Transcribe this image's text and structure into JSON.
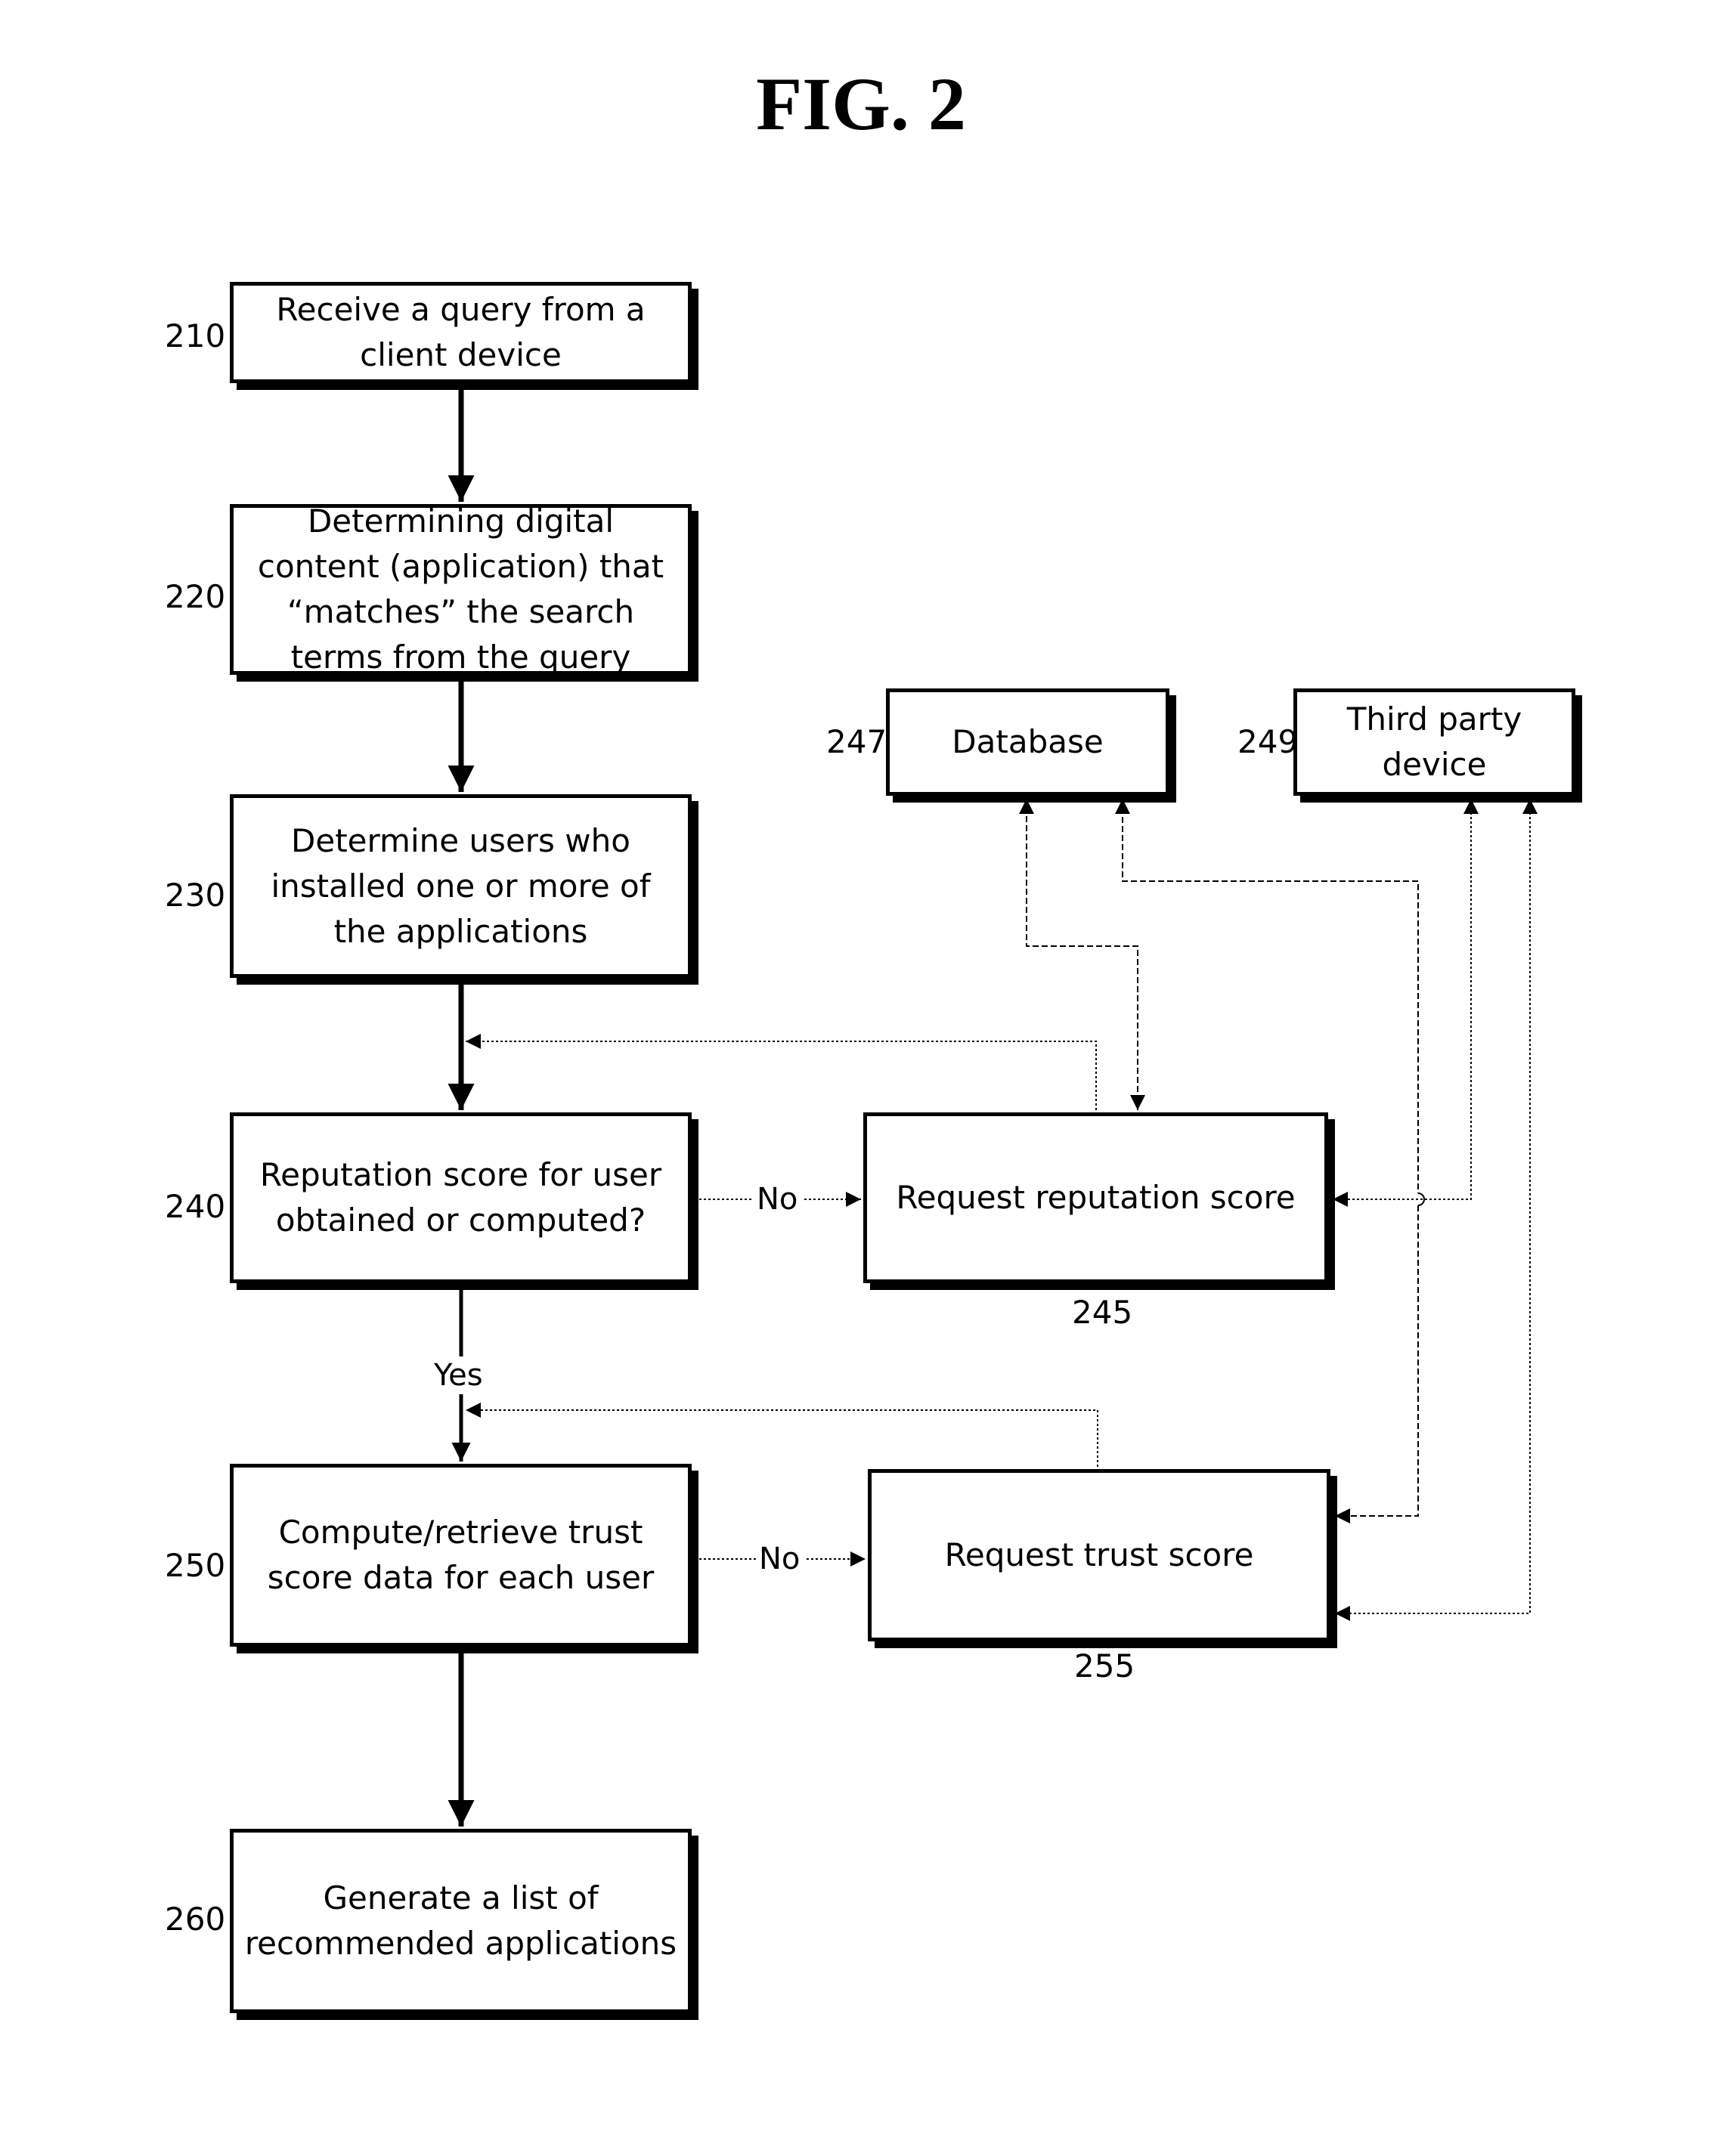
{
  "figure": {
    "title": "FIG. 2"
  },
  "nodes": {
    "n210": {
      "ref": "210",
      "text": "Receive a query from a client device"
    },
    "n220": {
      "ref": "220",
      "text": "Determining digital content (application) that “matches” the search terms from the query"
    },
    "n230": {
      "ref": "230",
      "text": "Determine users who installed one or more of the applications"
    },
    "n240": {
      "ref": "240",
      "text": "Reputation score for user obtained or computed?"
    },
    "n245": {
      "ref": "245",
      "text": "Request reputation score"
    },
    "n247": {
      "ref": "247",
      "text": "Database"
    },
    "n249": {
      "ref": "249",
      "text": "Third party device"
    },
    "n250": {
      "ref": "250",
      "text": "Compute/retrieve trust score data for each user"
    },
    "n255": {
      "ref": "255",
      "text": "Request trust score"
    },
    "n260": {
      "ref": "260",
      "text": "Generate a list of recommended applications"
    }
  },
  "edge_labels": {
    "no_240_245": "No",
    "yes_240_250": "Yes",
    "no_250_255": "No"
  },
  "edges": [
    {
      "from": "210",
      "to": "220",
      "style": "solid"
    },
    {
      "from": "220",
      "to": "230",
      "style": "solid"
    },
    {
      "from": "230",
      "to": "240",
      "style": "solid"
    },
    {
      "from": "240",
      "to": "245",
      "style": "dotted",
      "label": "No"
    },
    {
      "from": "240",
      "to": "250",
      "style": "solid",
      "label": "Yes"
    },
    {
      "from": "250",
      "to": "255",
      "style": "dotted",
      "label": "No"
    },
    {
      "from": "250",
      "to": "260",
      "style": "solid"
    },
    {
      "from": "245",
      "to": "240-input",
      "style": "dotted"
    },
    {
      "from": "255",
      "to": "250-input",
      "style": "dotted"
    },
    {
      "from": "245",
      "to": "247",
      "style": "dashed",
      "bidirectional": true
    },
    {
      "from": "247",
      "to": "255",
      "style": "dashed",
      "bidirectional": true
    },
    {
      "from": "249",
      "to": "245",
      "style": "dotted",
      "bidirectional": true
    },
    {
      "from": "249",
      "to": "255",
      "style": "dotted",
      "bidirectional": true
    }
  ]
}
